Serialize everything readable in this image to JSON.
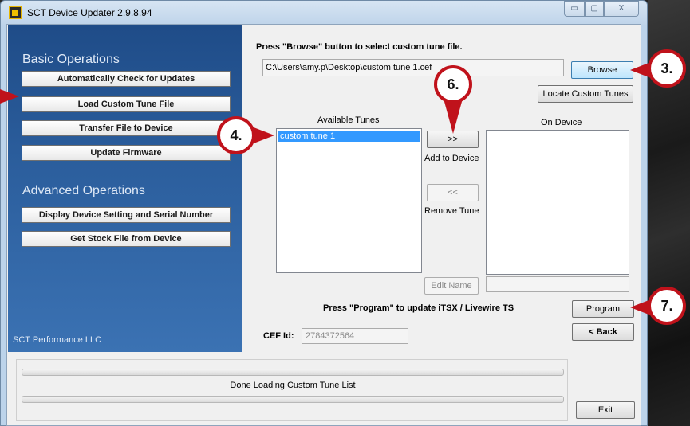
{
  "window": {
    "title": "SCT Device Updater 2.9.8.94",
    "min_glyph": "▭",
    "max_glyph": "▢",
    "close_glyph": "X"
  },
  "sidebar": {
    "basic_heading": "Basic Operations",
    "basic_buttons": [
      "Automatically Check for Updates",
      "Load Custom Tune File",
      "Transfer File to Device",
      "Update Firmware"
    ],
    "advanced_heading": "Advanced Operations",
    "advanced_buttons": [
      "Display Device Setting and Serial Number",
      "Get Stock File from Device"
    ],
    "company": "SCT Performance LLC"
  },
  "main": {
    "instruction": "Press \"Browse\" button to select custom tune file.",
    "file_path": "C:\\Users\\amy.p\\Desktop\\custom tune 1.cef",
    "browse_label": "Browse",
    "locate_label": "Locate Custom Tunes",
    "available_label": "Available Tunes",
    "available_items": [
      "custom tune 1"
    ],
    "on_device_label": "On Device",
    "add_button": ">>",
    "add_label": "Add to Device",
    "remove_button": "<<",
    "remove_label": "Remove Tune",
    "edit_name_label": "Edit Name",
    "program_prompt": "Press \"Program\" to update iTSX / Livewire TS",
    "program_label": "Program",
    "back_label": "< Back",
    "cef_label": "CEF Id:",
    "cef_value": "2784372564"
  },
  "status": {
    "message": "Done Loading Custom Tune List",
    "exit_label": "Exit"
  },
  "callouts": {
    "step3": "3.",
    "step4": "4.",
    "step6": "6.",
    "step7": "7."
  },
  "colors": {
    "sidebar": "#2c5f9e",
    "callout_red": "#c0121b",
    "selection": "#3399ff"
  }
}
